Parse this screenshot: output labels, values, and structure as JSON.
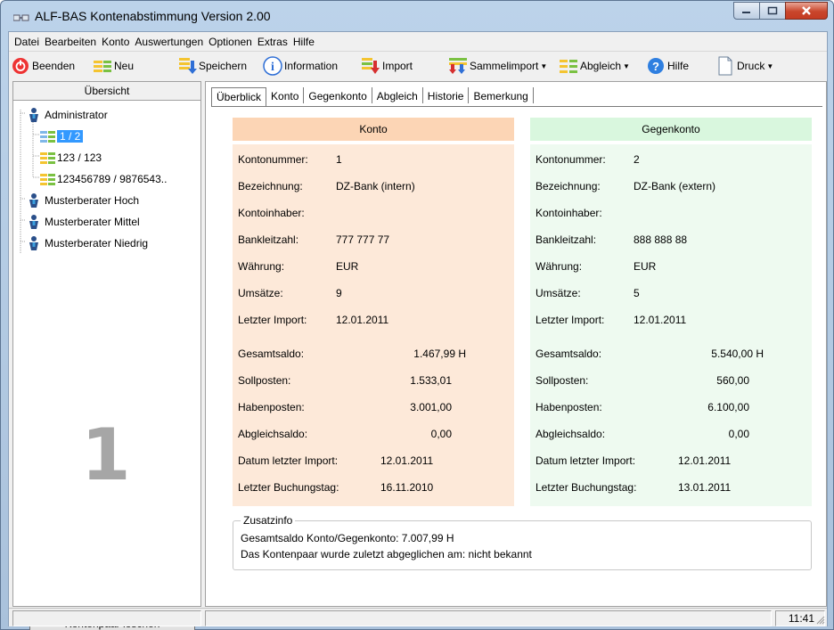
{
  "window": {
    "title": "ALF-BAS Kontenabstimmung Version 2.00"
  },
  "menu": [
    "Datei",
    "Bearbeiten",
    "Konto",
    "Auswertungen",
    "Optionen",
    "Extras",
    "Hilfe"
  ],
  "toolbar": {
    "beenden": "Beenden",
    "neu": "Neu",
    "speichern": "Speichern",
    "information": "Information",
    "import": "Import",
    "sammelimport": "Sammelimport",
    "abgleich": "Abgleich",
    "hilfe": "Hilfe",
    "druck": "Druck"
  },
  "left": {
    "header": "Übersicht",
    "tree": [
      {
        "label": "Administrator",
        "icon": "user-icon"
      },
      {
        "label": "1 / 2",
        "icon": "account-pair-icon",
        "selected": true
      },
      {
        "label": "123 / 123",
        "icon": "account-pair-icon"
      },
      {
        "label": "123456789 / 9876543..",
        "icon": "account-pair-icon"
      },
      {
        "label": "Musterberater Hoch",
        "icon": "user-icon"
      },
      {
        "label": "Musterberater Mittel",
        "icon": "user-icon"
      },
      {
        "label": "Musterberater Niedrig",
        "icon": "user-icon"
      }
    ],
    "big_number": "1",
    "delete_button": "Kontenpaar löschen"
  },
  "tabs": [
    "Überblick",
    "Konto",
    "Gegenkonto",
    "Abgleich",
    "Historie",
    "Bemerkung"
  ],
  "konto": {
    "header": "Konto",
    "color": "#fde9d9",
    "header_color": "#fcd5b5",
    "kontonummer_label": "Kontonummer:",
    "kontonummer": "1",
    "bezeichnung_label": "Bezeichnung:",
    "bezeichnung": "DZ-Bank (intern)",
    "kontoinhaber_label": "Kontoinhaber:",
    "kontoinhaber": "",
    "blz_label": "Bankleitzahl:",
    "blz": "777 777 77",
    "waehrung_label": "Währung:",
    "waehrung": "EUR",
    "umsaetze_label": "Umsätze:",
    "umsaetze": "9",
    "letzter_import_label": "Letzter Import:",
    "letzter_import": "12.01.2011",
    "gesamtsaldo_label": "Gesamtsaldo:",
    "gesamtsaldo": "1.467,99 H",
    "sollposten_label": "Sollposten:",
    "sollposten": "1.533,01",
    "habenposten_label": "Habenposten:",
    "habenposten": "3.001,00",
    "abgleichsaldo_label": "Abgleichsaldo:",
    "abgleichsaldo": "0,00",
    "datum_import_label": "Datum letzter Import:",
    "datum_import": "12.01.2011",
    "buchungstag_label": "Letzter Buchungstag:",
    "buchungstag": "16.11.2010"
  },
  "gegenkonto": {
    "header": "Gegenkonto",
    "color": "#eefaf0",
    "header_color": "#d9f7de",
    "kontonummer_label": "Kontonummer:",
    "kontonummer": "2",
    "bezeichnung_label": "Bezeichnung:",
    "bezeichnung": "DZ-Bank (extern)",
    "kontoinhaber_label": "Kontoinhaber:",
    "kontoinhaber": "",
    "blz_label": "Bankleitzahl:",
    "blz": "888 888 88",
    "waehrung_label": "Währung:",
    "waehrung": "EUR",
    "umsaetze_label": "Umsätze:",
    "umsaetze": "5",
    "letzter_import_label": "Letzter Import:",
    "letzter_import": "12.01.2011",
    "gesamtsaldo_label": "Gesamtsaldo:",
    "gesamtsaldo": "5.540,00 H",
    "sollposten_label": "Sollposten:",
    "sollposten": "560,00",
    "habenposten_label": "Habenposten:",
    "habenposten": "6.100,00",
    "abgleichsaldo_label": "Abgleichsaldo:",
    "abgleichsaldo": "0,00",
    "datum_import_label": "Datum letzter Import:",
    "datum_import": "12.01.2011",
    "buchungstag_label": "Letzter Buchungstag:",
    "buchungstag": "13.01.2011"
  },
  "zusatzinfo": {
    "legend": "Zusatzinfo",
    "line1": "Gesamtsaldo Konto/Gegenkonto: 7.007,99 H",
    "line2": "Das Kontenpaar wurde zuletzt abgeglichen am:  nicht bekannt"
  },
  "status": {
    "time": "11:41"
  }
}
